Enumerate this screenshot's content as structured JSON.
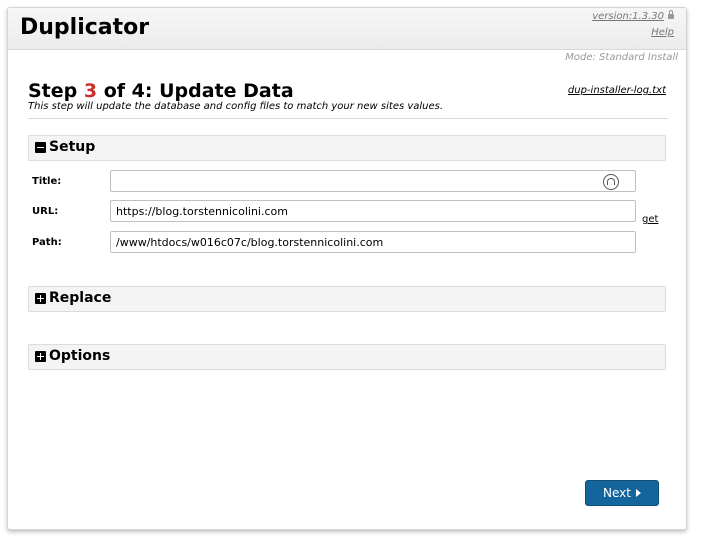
{
  "header": {
    "brand": "Duplicator",
    "version": "version:1.3.30",
    "help": "Help"
  },
  "mode": "Mode: Standard Install",
  "step": {
    "prefix": "Step",
    "number": "3",
    "suffix": "of 4: Update Data",
    "description": "This step will update the database and config files to match your new sites values.",
    "log_link": "dup-installer-log.txt"
  },
  "sections": {
    "setup": {
      "label": "Setup",
      "expanded": true
    },
    "replace": {
      "label": "Replace",
      "expanded": false
    },
    "options": {
      "label": "Options",
      "expanded": false
    }
  },
  "setup": {
    "title": {
      "label": "Title:",
      "value": ""
    },
    "url": {
      "label": "URL:",
      "value": "https://blog.torstennicolini.com",
      "get_link": "get"
    },
    "path": {
      "label": "Path:",
      "value": "/www/htdocs/w016c07c/blog.torstennicolini.com"
    }
  },
  "buttons": {
    "next": "Next"
  },
  "colors": {
    "accent": "#c9302c",
    "button": "#13659c"
  }
}
